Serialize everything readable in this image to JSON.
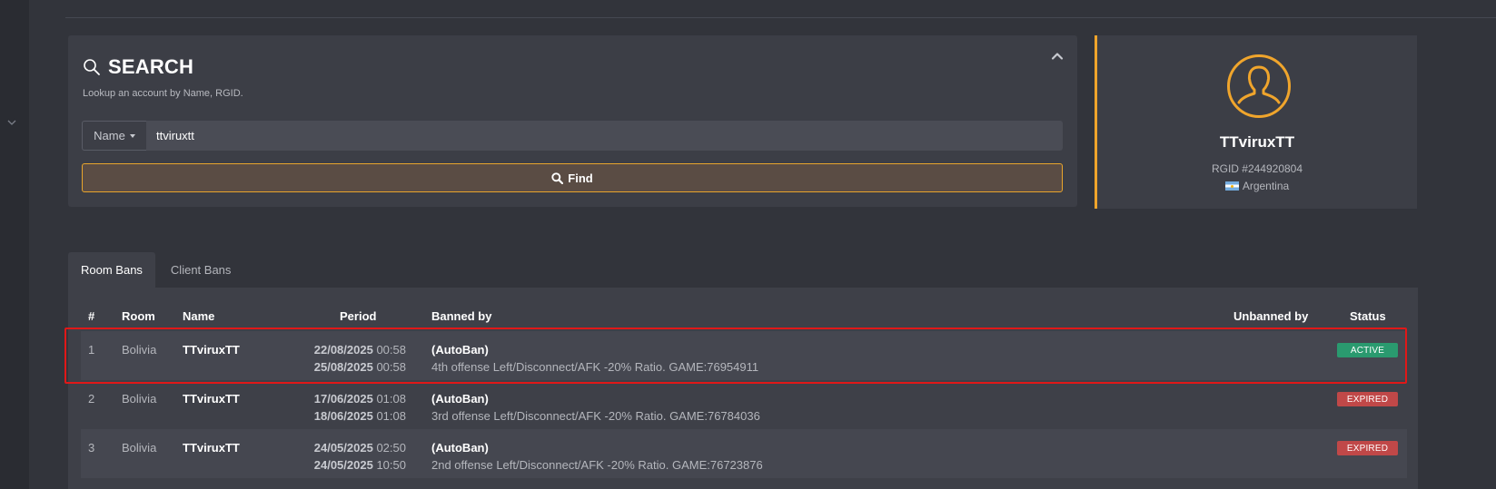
{
  "colors": {
    "accent": "#f0a52c",
    "active_badge": "#2a9a6f",
    "expired_badge": "#c04848",
    "highlight": "#e01818"
  },
  "search": {
    "title": "SEARCH",
    "subtitle": "Lookup an account by Name, RGID.",
    "filter_label": "Name",
    "query_value": "ttviruxtt",
    "find_label": "Find",
    "icons": [
      "search-icon",
      "chevron-up-icon",
      "caret-down-icon"
    ]
  },
  "profile": {
    "name": "TTviruxTT",
    "rgid": "RGID #244920804",
    "country": "Argentina",
    "icons": [
      "user-avatar-icon",
      "argentina-flag-icon"
    ]
  },
  "tabs": [
    {
      "label": "Room Bans",
      "active": true
    },
    {
      "label": "Client Bans",
      "active": false
    }
  ],
  "table": {
    "headers": {
      "num": "#",
      "room": "Room",
      "name": "Name",
      "period": "Period",
      "banned_by": "Banned by",
      "unbanned_by": "Unbanned by",
      "status": "Status"
    },
    "rows": [
      {
        "num": "1",
        "room": "Bolivia",
        "name": "TTviruxTT",
        "start_date": "22/08/2025",
        "start_time": "00:58",
        "end_date": "25/08/2025",
        "end_time": "00:58",
        "banned_by": "(AutoBan)",
        "reason": "4th offense Left/Disconnect/AFK -20% Ratio. GAME:76954911",
        "unbanned_by": "",
        "status": "ACTIVE"
      },
      {
        "num": "2",
        "room": "Bolivia",
        "name": "TTviruxTT",
        "start_date": "17/06/2025",
        "start_time": "01:08",
        "end_date": "18/06/2025",
        "end_time": "01:08",
        "banned_by": "(AutoBan)",
        "reason": "3rd offense Left/Disconnect/AFK -20% Ratio. GAME:76784036",
        "unbanned_by": "",
        "status": "EXPIRED"
      },
      {
        "num": "3",
        "room": "Bolivia",
        "name": "TTviruxTT",
        "start_date": "24/05/2025",
        "start_time": "02:50",
        "end_date": "24/05/2025",
        "end_time": "10:50",
        "banned_by": "(AutoBan)",
        "reason": "2nd offense Left/Disconnect/AFK -20% Ratio. GAME:76723876",
        "unbanned_by": "",
        "status": "EXPIRED"
      }
    ]
  }
}
